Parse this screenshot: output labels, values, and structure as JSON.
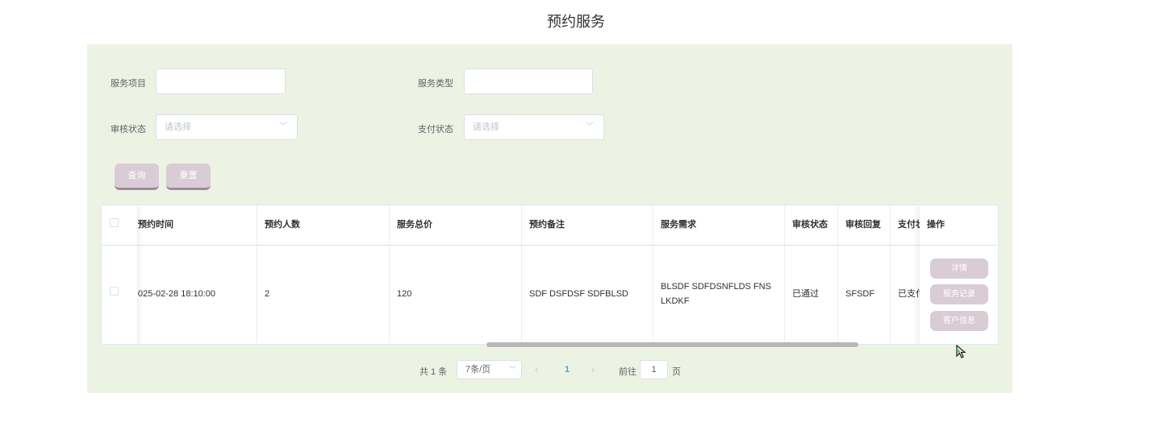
{
  "page_title": "预约服务",
  "search": {
    "service_item_label": "服务项目",
    "service_item_value": "",
    "service_type_label": "服务类型",
    "service_type_value": "",
    "audit_status_label": "审核状态",
    "audit_status_placeholder": "请选择",
    "pay_status_label": "支付状态",
    "pay_status_placeholder": "请选择",
    "query_button": "查询",
    "reset_button": "重置"
  },
  "table": {
    "headers": [
      "预约时间",
      "预约人数",
      "服务总价",
      "预约备注",
      "服务需求",
      "审核状态",
      "审核回复",
      "支付状",
      "操作"
    ],
    "rows": [
      {
        "time": "025-02-28 18:10:00",
        "people": "2",
        "price": "120",
        "remark": "SDF DSFDSF SDFBLSD",
        "demand": "BLSDF SDFDSNFLDS FNS LKDKF",
        "audit_status": "已通过",
        "audit_reply": "SFSDF",
        "pay_status": "已支付",
        "actions": [
          "详情",
          "服务记录",
          "客户信息"
        ]
      }
    ]
  },
  "pagination": {
    "total_text": "共 1 条",
    "page_size": "7条/页",
    "current_page": "1",
    "goto_label": "前往",
    "goto_value": "1",
    "page_suffix": "页"
  }
}
